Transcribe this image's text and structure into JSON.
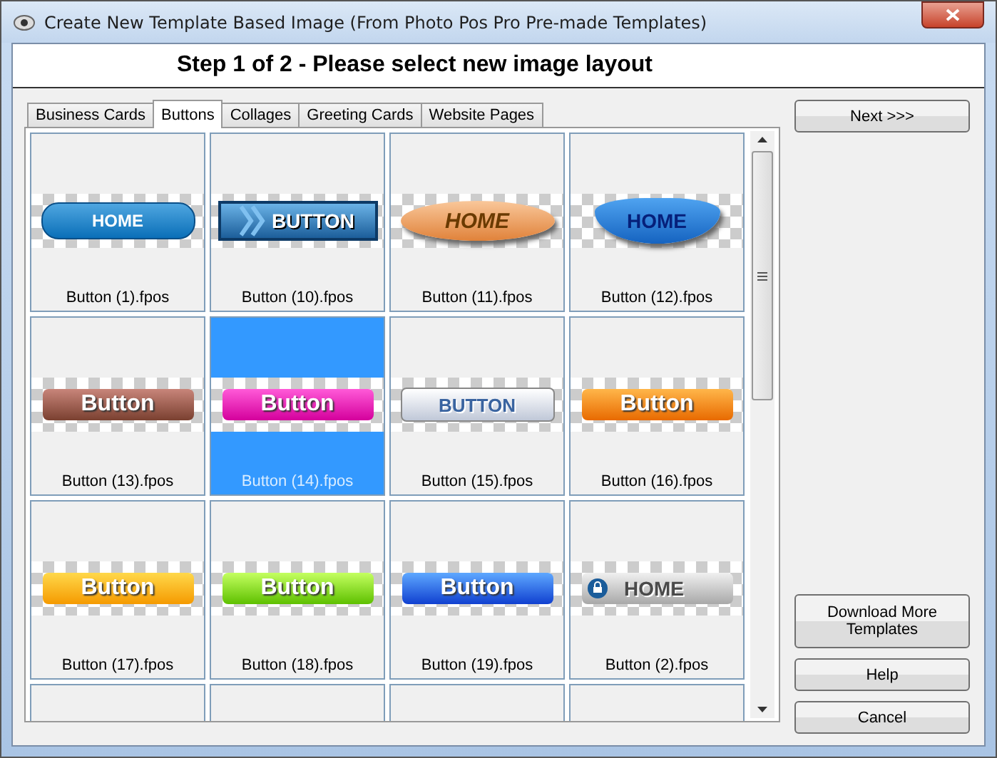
{
  "window": {
    "title": "Create New Template Based Image (From Photo Pos Pro Pre-made Templates)"
  },
  "header": {
    "title": "Step 1 of 2 - Please select new image layout"
  },
  "tabs": [
    {
      "label": "Business Cards",
      "selected": false
    },
    {
      "label": "Buttons",
      "selected": true
    },
    {
      "label": "Collages",
      "selected": false
    },
    {
      "label": "Greeting Cards",
      "selected": false
    },
    {
      "label": "Website Pages",
      "selected": false
    }
  ],
  "templates": [
    {
      "label": "Button (1).fpos",
      "preview_text": "HOME",
      "kind": "glossy-pill",
      "selected": false
    },
    {
      "label": "Button (10).fpos",
      "preview_text": "BUTTON",
      "kind": "arrow-banner",
      "selected": false
    },
    {
      "label": "Button (11).fpos",
      "preview_text": "HOME",
      "kind": "ellipse",
      "selected": false
    },
    {
      "label": "Button (12).fpos",
      "preview_text": "HOME",
      "kind": "wave",
      "selected": false
    },
    {
      "label": "Button (13).fpos",
      "preview_text": "Button",
      "kind": "brown-bar",
      "selected": false
    },
    {
      "label": "Button (14).fpos",
      "preview_text": "Button",
      "kind": "magenta-bar",
      "selected": true
    },
    {
      "label": "Button (15).fpos",
      "preview_text": "BUTTON",
      "kind": "silver-bar",
      "selected": false
    },
    {
      "label": "Button (16).fpos",
      "preview_text": "Button",
      "kind": "orange-bar",
      "selected": false
    },
    {
      "label": "Button (17).fpos",
      "preview_text": "Button",
      "kind": "yellow-bar",
      "selected": false
    },
    {
      "label": "Button (18).fpos",
      "preview_text": "Button",
      "kind": "green-bar",
      "selected": false
    },
    {
      "label": "Button (19).fpos",
      "preview_text": "Button",
      "kind": "blue-bar",
      "selected": false
    },
    {
      "label": "Button (2).fpos",
      "preview_text": "HOME",
      "kind": "grey-home",
      "selected": false
    },
    {
      "kind": "blank",
      "selected": false
    },
    {
      "kind": "blank",
      "selected": false
    },
    {
      "kind": "blank",
      "selected": false
    },
    {
      "kind": "blank",
      "selected": false
    }
  ],
  "buttons": {
    "next": "Next >>>",
    "download": "Download More Templates",
    "help": "Help",
    "cancel": "Cancel"
  }
}
